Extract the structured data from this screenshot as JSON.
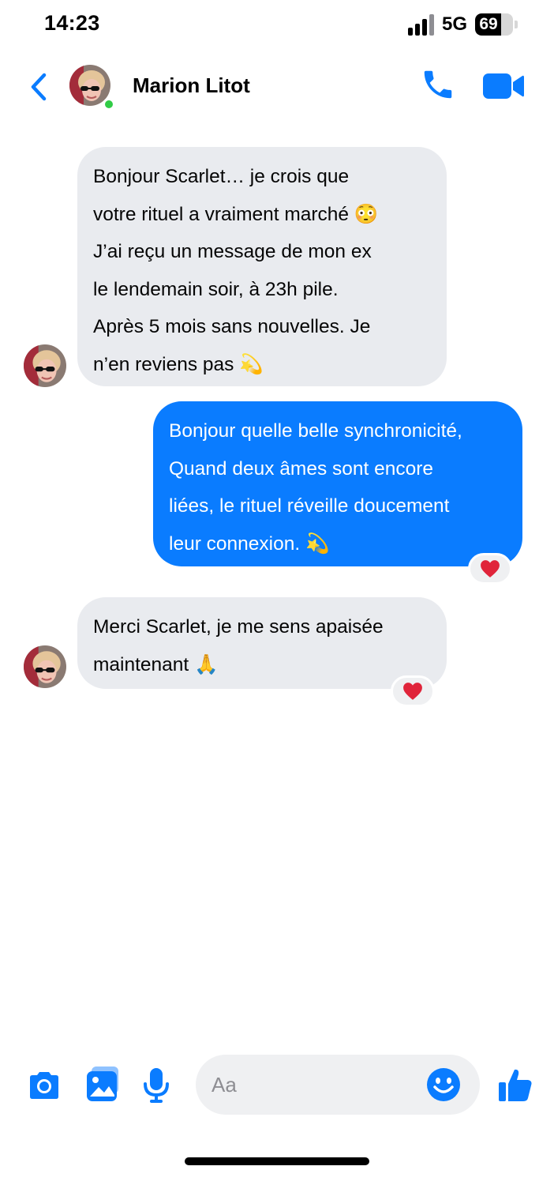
{
  "status_bar": {
    "time": "14:23",
    "network": "5G",
    "battery_level": "69",
    "battery_fraction": 0.69
  },
  "header": {
    "contact_name": "Marion Litot",
    "online": true,
    "back_icon": "chevron-left-icon",
    "call_icon": "phone-icon",
    "video_icon": "video-camera-icon"
  },
  "messages": [
    {
      "direction": "incoming",
      "lines": [
        "Bonjour Scarlet… je crois que",
        "votre rituel a vraiment marché 😳",
        "J’ai reçu un message de mon ex",
        "le lendemain soir, à 23h pile.",
        "Après 5 mois sans nouvelles. Je",
        "n’en reviens pas 💫"
      ]
    },
    {
      "direction": "outgoing",
      "lines": [
        "Bonjour quelle belle synchronicité,",
        "Quand deux âmes sont encore",
        "liées, le rituel réveille doucement",
        "leur connexion. 💫"
      ],
      "reaction": "❤️"
    },
    {
      "direction": "incoming",
      "lines": [
        "Merci Scarlet, je me sens apaisée",
        "maintenant 🙏"
      ],
      "reaction": "❤️"
    }
  ],
  "composer": {
    "placeholder": "Aa",
    "icons": [
      "camera-icon",
      "photo-gallery-icon",
      "microphone-icon",
      "emoji-icon",
      "thumbs-up-icon"
    ]
  },
  "colors": {
    "accent": "#0a7cff",
    "incoming_bubble": "#e9ebef",
    "online": "#31cc46"
  }
}
